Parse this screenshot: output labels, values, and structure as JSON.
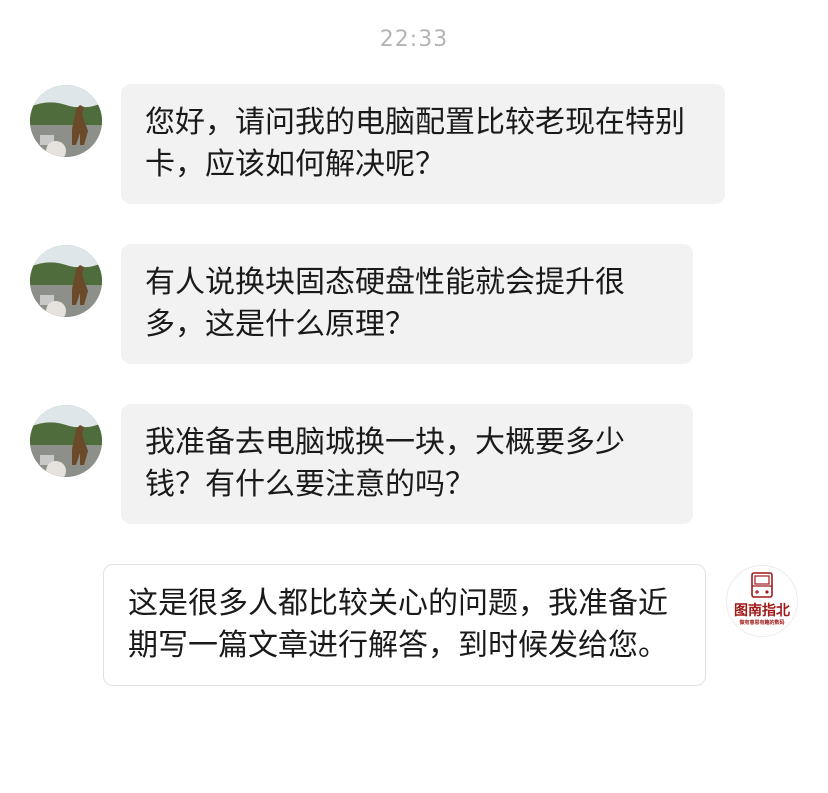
{
  "chat": {
    "timestamp": "22:33",
    "messages": [
      {
        "sender": "user",
        "text": "您好，请问我的电脑配置比较老现在特别卡，应该如何解决呢？"
      },
      {
        "sender": "user",
        "text": "有人说换块固态硬盘性能就会提升很多，这是什么原理？"
      },
      {
        "sender": "user",
        "text": "我准备去电脑城换一块，大概要多少钱？有什么要注意的吗？"
      },
      {
        "sender": "official",
        "text": "这是很多人都比较关心的问题，我准备近期写一篇文章进行解答，到时候发给您。"
      }
    ],
    "official_logo": {
      "name": "图南指北",
      "slogan": "做有意思有趣的数码"
    }
  }
}
